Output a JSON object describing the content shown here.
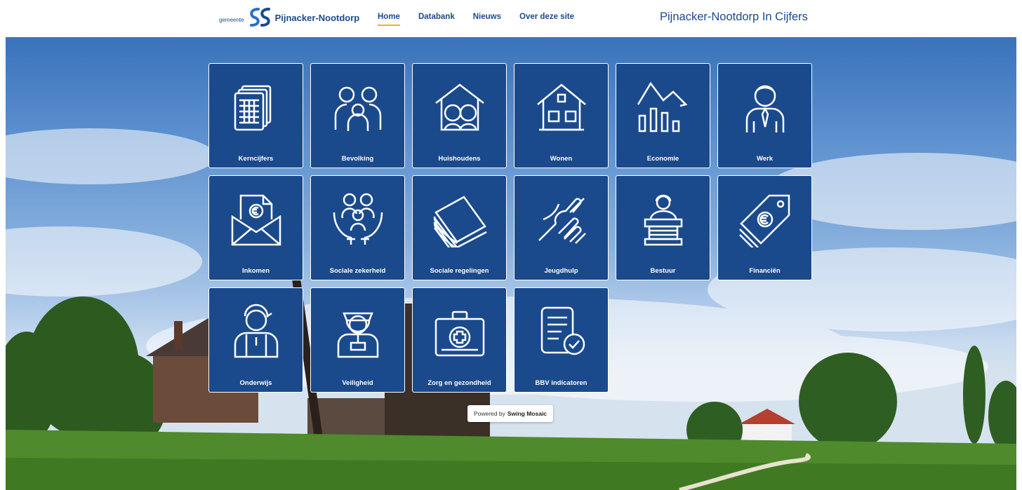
{
  "header": {
    "logo_prefix": "gemeente",
    "logo_name": "Pijnacker-Nootdorp",
    "nav": [
      {
        "label": "Home",
        "active": true
      },
      {
        "label": "Databank",
        "active": false
      },
      {
        "label": "Nieuws",
        "active": false
      },
      {
        "label": "Over deze site",
        "active": false
      }
    ],
    "site_title": "Pijnacker-Nootdorp In Cijfers"
  },
  "tiles": [
    {
      "label": "Kerncijfers",
      "icon": "documents-table-icon"
    },
    {
      "label": "Bevolking",
      "icon": "family-icon"
    },
    {
      "label": "Huishoudens",
      "icon": "house-couple-icon"
    },
    {
      "label": "Wonen",
      "icon": "house-icon"
    },
    {
      "label": "Economie",
      "icon": "bar-chart-trend-icon"
    },
    {
      "label": "Werk",
      "icon": "businessman-icon"
    },
    {
      "label": "Inkomen",
      "icon": "euro-envelope-icon"
    },
    {
      "label": "Sociale zekerheid",
      "icon": "hands-family-icon"
    },
    {
      "label": "Sociale regelingen",
      "icon": "money-stack-icon"
    },
    {
      "label": "Jeugdhulp",
      "icon": "helping-hands-icon"
    },
    {
      "label": "Bestuur",
      "icon": "speaker-podium-icon"
    },
    {
      "label": "Financiën",
      "icon": "euro-tag-icon"
    },
    {
      "label": "Onderwijs",
      "icon": "student-icon"
    },
    {
      "label": "Veiligheid",
      "icon": "police-officer-icon"
    },
    {
      "label": "Zorg en gezondheid",
      "icon": "first-aid-kit-icon"
    },
    {
      "label": "BBV indicatoren",
      "icon": "checklist-document-icon"
    }
  ],
  "footer": {
    "powered_prefix": "Powered by",
    "powered_brand": "Swing Mosaic"
  },
  "colors": {
    "brand_blue": "#1b4a8c",
    "accent_yellow": "#f0b400"
  }
}
